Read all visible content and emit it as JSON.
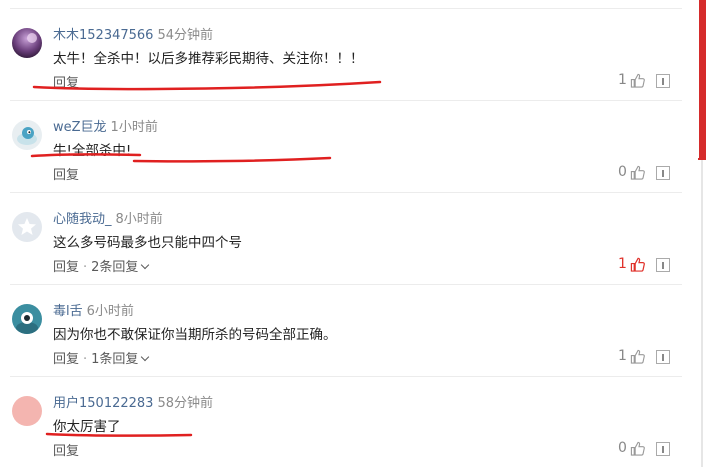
{
  "comments": [
    {
      "username": "木木152347566",
      "time": "54分钟前",
      "content": "太牛！全杀中！以后多推荐彩民期待、关注你！！！",
      "reply_label": "回复",
      "replies_label": "",
      "likes": "1",
      "liked": false,
      "avatar_icon": "purple-gradient-avatar",
      "underlined": true
    },
    {
      "username": "weZ巨龙",
      "time": "1小时前",
      "content": "牛!全部杀中!",
      "reply_label": "回复",
      "replies_label": "",
      "likes": "0",
      "liked": false,
      "avatar_icon": "blue-cartoon-avatar",
      "underlined": true
    },
    {
      "username": "心随我动_",
      "time": "8小时前",
      "content": "这么多号码最多也只能中四个号",
      "reply_label": "回复",
      "replies_label": "2条回复",
      "likes": "1",
      "liked": true,
      "avatar_icon": "gray-star-avatar",
      "underlined": false
    },
    {
      "username": "毒l舌",
      "time": "6小时前",
      "content": "因为你也不敢保证你当期所杀的号码全部正确。",
      "reply_label": "回复",
      "replies_label": "1条回复",
      "likes": "1",
      "liked": false,
      "avatar_icon": "teal-eye-avatar",
      "underlined": false
    },
    {
      "username": "用户150122283",
      "time": "58分钟前",
      "content": "你太厉害了",
      "reply_label": "回复",
      "replies_label": "",
      "likes": "0",
      "liked": false,
      "avatar_icon": "pink-default-avatar",
      "underlined": true
    }
  ],
  "colors": {
    "username": "#4a6a92",
    "liked": "#e0322b",
    "annotation_red": "#e02020"
  }
}
